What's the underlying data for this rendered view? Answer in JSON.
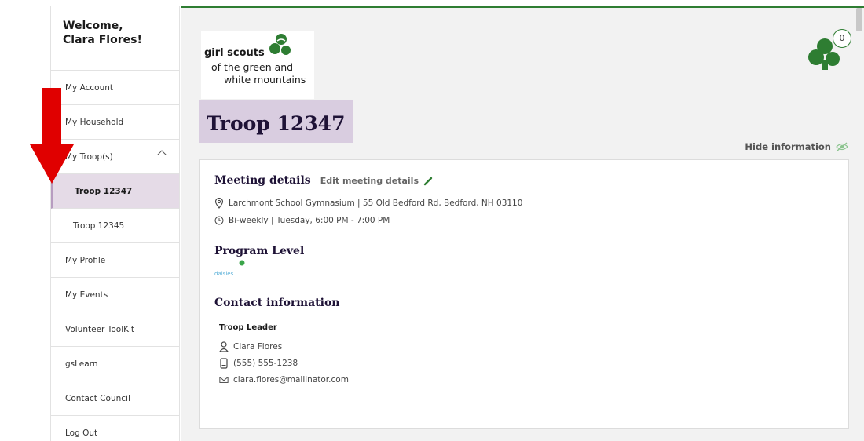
{
  "sidebar": {
    "welcome_line1": "Welcome,",
    "welcome_line2": "Clara Flores!",
    "items": [
      {
        "label": "My Account"
      },
      {
        "label": "My Household"
      },
      {
        "label": "My Troop(s)"
      },
      {
        "label": "Troop 12347"
      },
      {
        "label": "Troop 12345"
      },
      {
        "label": "My Profile"
      },
      {
        "label": "My Events"
      },
      {
        "label": "Volunteer ToolKit"
      },
      {
        "label": "gsLearn"
      },
      {
        "label": "Contact Council"
      },
      {
        "label": "Log Out"
      }
    ]
  },
  "logo": {
    "line1": "girl scouts",
    "line2": "of the green and",
    "line3": "white mountains"
  },
  "header": {
    "troop_title": "Troop 12347",
    "cart_count": "0",
    "hide_info": "Hide information"
  },
  "meeting": {
    "heading": "Meeting details",
    "edit_label": "Edit meeting details",
    "location": "Larchmont School Gymnasium | 55 Old Bedford Rd, Bedford, NH 03110",
    "schedule": "Bi-weekly | Tuesday, 6:00 PM - 7:00 PM"
  },
  "program": {
    "heading": "Program Level",
    "badge_text": "daisies"
  },
  "contact": {
    "heading": "Contact information",
    "role": "Troop Leader",
    "name": "Clara Flores",
    "phone": "(555) 555-1238",
    "email": "clara.flores@mailinator.com"
  },
  "colors": {
    "brand_green": "#2e7d32",
    "active_purple": "#e5dbe7",
    "arrow_red": "#e00000"
  }
}
